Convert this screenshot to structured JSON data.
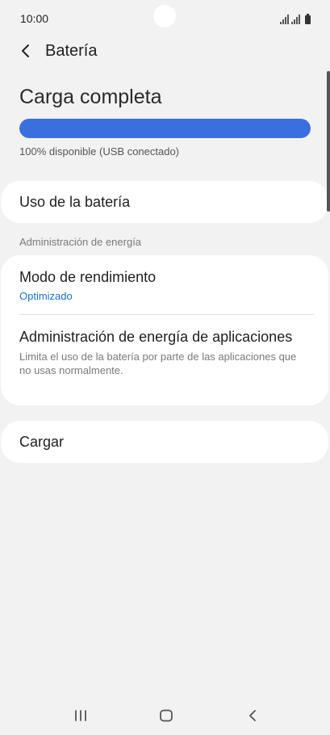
{
  "status_bar": {
    "time": "10:00"
  },
  "header": {
    "title": "Batería"
  },
  "battery": {
    "title": "Carga completa",
    "level_percent": 100,
    "subtitle": "100% disponible (USB conectado)"
  },
  "battery_usage": {
    "label": "Uso de la batería"
  },
  "power_management": {
    "section_label": "Administración de energía",
    "performance_mode": {
      "title": "Modo de rendimiento",
      "value": "Optimizado"
    },
    "app_power_management": {
      "title": "Administración de energía de aplicaciones",
      "description": "Limita el uso de la batería por parte de las aplicaciones que no usas normalmente."
    }
  },
  "charging": {
    "label": "Cargar"
  },
  "colors": {
    "accent": "#3a6fe0",
    "link": "#1a73c8",
    "background": "#f2f2f2"
  },
  "icons": {
    "back": "chevron-left-icon",
    "recents": "recents-icon",
    "home": "home-icon",
    "nav_back": "back-icon"
  }
}
